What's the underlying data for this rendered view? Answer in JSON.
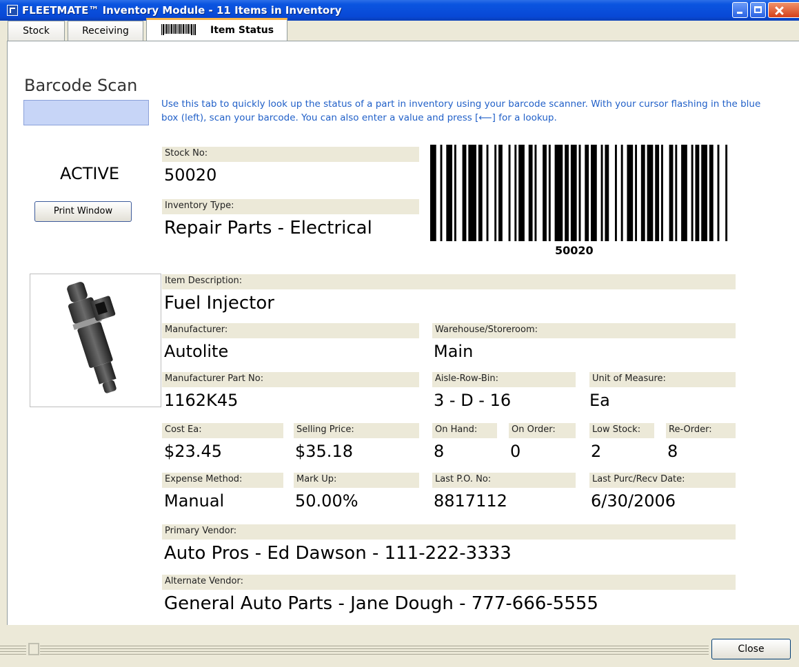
{
  "window": {
    "title": "FLEETMATE™ Inventory Module - 11 Items in Inventory",
    "accent": "#0b55e0"
  },
  "tabs": [
    {
      "label": "Stock"
    },
    {
      "label": "Receiving"
    },
    {
      "label": "Item Status",
      "icon": "barcode-icon",
      "selected": true
    }
  ],
  "scan": {
    "heading": "Barcode Scan",
    "help": "Use this tab to quickly look up the status of a part in inventory using your barcode scanner. With your cursor flashing in the blue box (left), scan your barcode. You can also enter a value and press [⟵] for a lookup."
  },
  "item": {
    "status": "ACTIVE",
    "print_label": "Print Window",
    "barcode_value": "50020",
    "fields": {
      "stock_no": {
        "label": "Stock No:",
        "value": "50020"
      },
      "inventory_type": {
        "label": "Inventory Type:",
        "value": "Repair Parts - Electrical"
      },
      "description": {
        "label": "Item Description:",
        "value": "Fuel Injector"
      },
      "manufacturer": {
        "label": "Manufacturer:",
        "value": "Autolite"
      },
      "warehouse": {
        "label": "Warehouse/Storeroom:",
        "value": "Main"
      },
      "mfr_part_no": {
        "label": "Manufacturer Part No:",
        "value": "1162K45"
      },
      "aisle_row_bin": {
        "label": "Aisle-Row-Bin:",
        "value": "3 - D - 16"
      },
      "uom": {
        "label": "Unit of Measure:",
        "value": "Ea"
      },
      "cost_ea": {
        "label": "Cost Ea:",
        "value": "$23.45"
      },
      "selling_price": {
        "label": "Selling Price:",
        "value": "$35.18"
      },
      "on_hand": {
        "label": "On Hand:",
        "value": "8"
      },
      "on_order": {
        "label": "On Order:",
        "value": "0"
      },
      "low_stock": {
        "label": "Low Stock:",
        "value": "2"
      },
      "re_order": {
        "label": "Re-Order:",
        "value": "8"
      },
      "expense_method": {
        "label": "Expense Method:",
        "value": "Manual"
      },
      "mark_up": {
        "label": "Mark Up:",
        "value": "50.00%"
      },
      "last_po": {
        "label": "Last P.O. No:",
        "value": "8817112"
      },
      "last_date": {
        "label": "Last Purc/Recv Date:",
        "value": "6/30/2006"
      },
      "primary_vendor": {
        "label": "Primary Vendor:",
        "value": "Auto Pros - Ed Dawson - 111-222-3333"
      },
      "alternate_vendor": {
        "label": "Alternate Vendor:",
        "value": "General Auto Parts - Jane Dough - 777-666-5555"
      }
    }
  },
  "footer": {
    "close_label": "Close"
  }
}
